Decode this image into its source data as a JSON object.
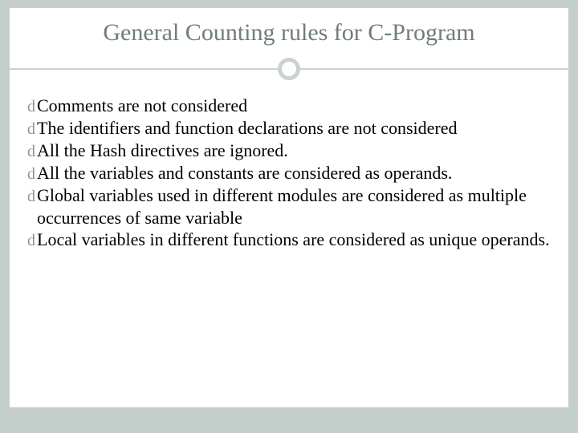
{
  "slide": {
    "title": "General Counting rules for C-Program",
    "bullets": [
      "Comments are not considered",
      "The identifiers and function declarations are not considered",
      "All the Hash directives are ignored.",
      "All the variables and constants are considered as operands.",
      "Global variables used in different modules are considered as multiple occurrences of same variable",
      "Local variables in different functions are considered as unique operands."
    ],
    "bullet_glyph": "d"
  }
}
